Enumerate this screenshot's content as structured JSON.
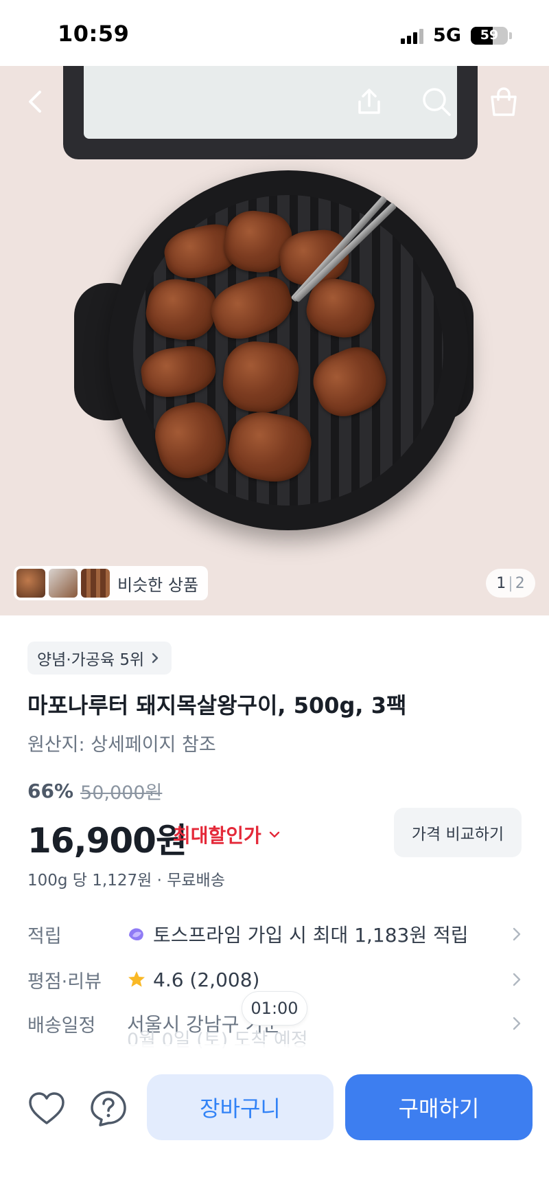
{
  "status_bar": {
    "time": "10:59",
    "network": "5G",
    "battery_percent": 59,
    "battery_label": "59"
  },
  "nav": {
    "back_icon": "chevron-left-icon",
    "share_icon": "share-icon",
    "search_icon": "search-icon",
    "cart_icon": "shopping-bag-icon"
  },
  "gallery": {
    "similar_label": "비슷한 상품",
    "page_current": "1",
    "page_separator": "|",
    "page_total": "2"
  },
  "product": {
    "category_rank": "양념·가공육 5위",
    "title": "마포나루터 돼지목살왕구이, 500g, 3팩",
    "origin": "원산지: 상세페이지 참조",
    "discount_percent": "66%",
    "original_price": "50,000원",
    "price": "16,900원",
    "best_price_label": "최대할인가",
    "compare_button": "가격 비교하기",
    "unit_price": "100g 당 1,127원 · 무료배송"
  },
  "info_rows": [
    {
      "label": "적립",
      "value": "토스프라임 가입 시 최대 1,183원 적립",
      "icon": "toss-prime-icon"
    },
    {
      "label": "평점·리뷰",
      "value": "4.6 (2,008)",
      "icon": "star-icon"
    },
    {
      "label": "배송일정",
      "value": "서울시 강남구 기준",
      "icon": ""
    }
  ],
  "delivery_faded": "0월 0일 (토) 도착 예정",
  "timer": "01:00",
  "bottom": {
    "like_icon": "heart-icon",
    "help_icon": "question-icon",
    "cart_button": "장바구니",
    "buy_button": "구매하기"
  },
  "colors": {
    "accent_blue": "#3182f6",
    "buy_button": "#3d7ef0",
    "cart_button_bg": "#e3ecfd",
    "discount_red": "#e42939",
    "star": "#f9b825"
  }
}
